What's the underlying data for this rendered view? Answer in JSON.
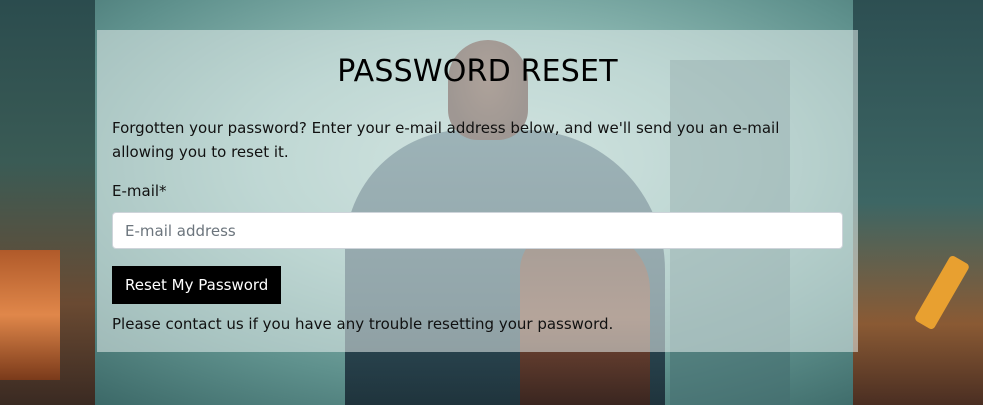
{
  "form": {
    "title": "PASSWORD RESET",
    "intro": "Forgotten your password? Enter your e-mail address below, and we'll send you an e-mail allowing you to reset it.",
    "email_label": "E-mail*",
    "email_placeholder": "E-mail address",
    "email_value": "",
    "submit_label": "Reset My Password",
    "footer_note": "Please contact us if you have any trouble resetting your password."
  },
  "colors": {
    "button_bg": "#000000",
    "button_text": "#ffffff",
    "panel_bg": "rgba(230,238,236,0.55)"
  }
}
